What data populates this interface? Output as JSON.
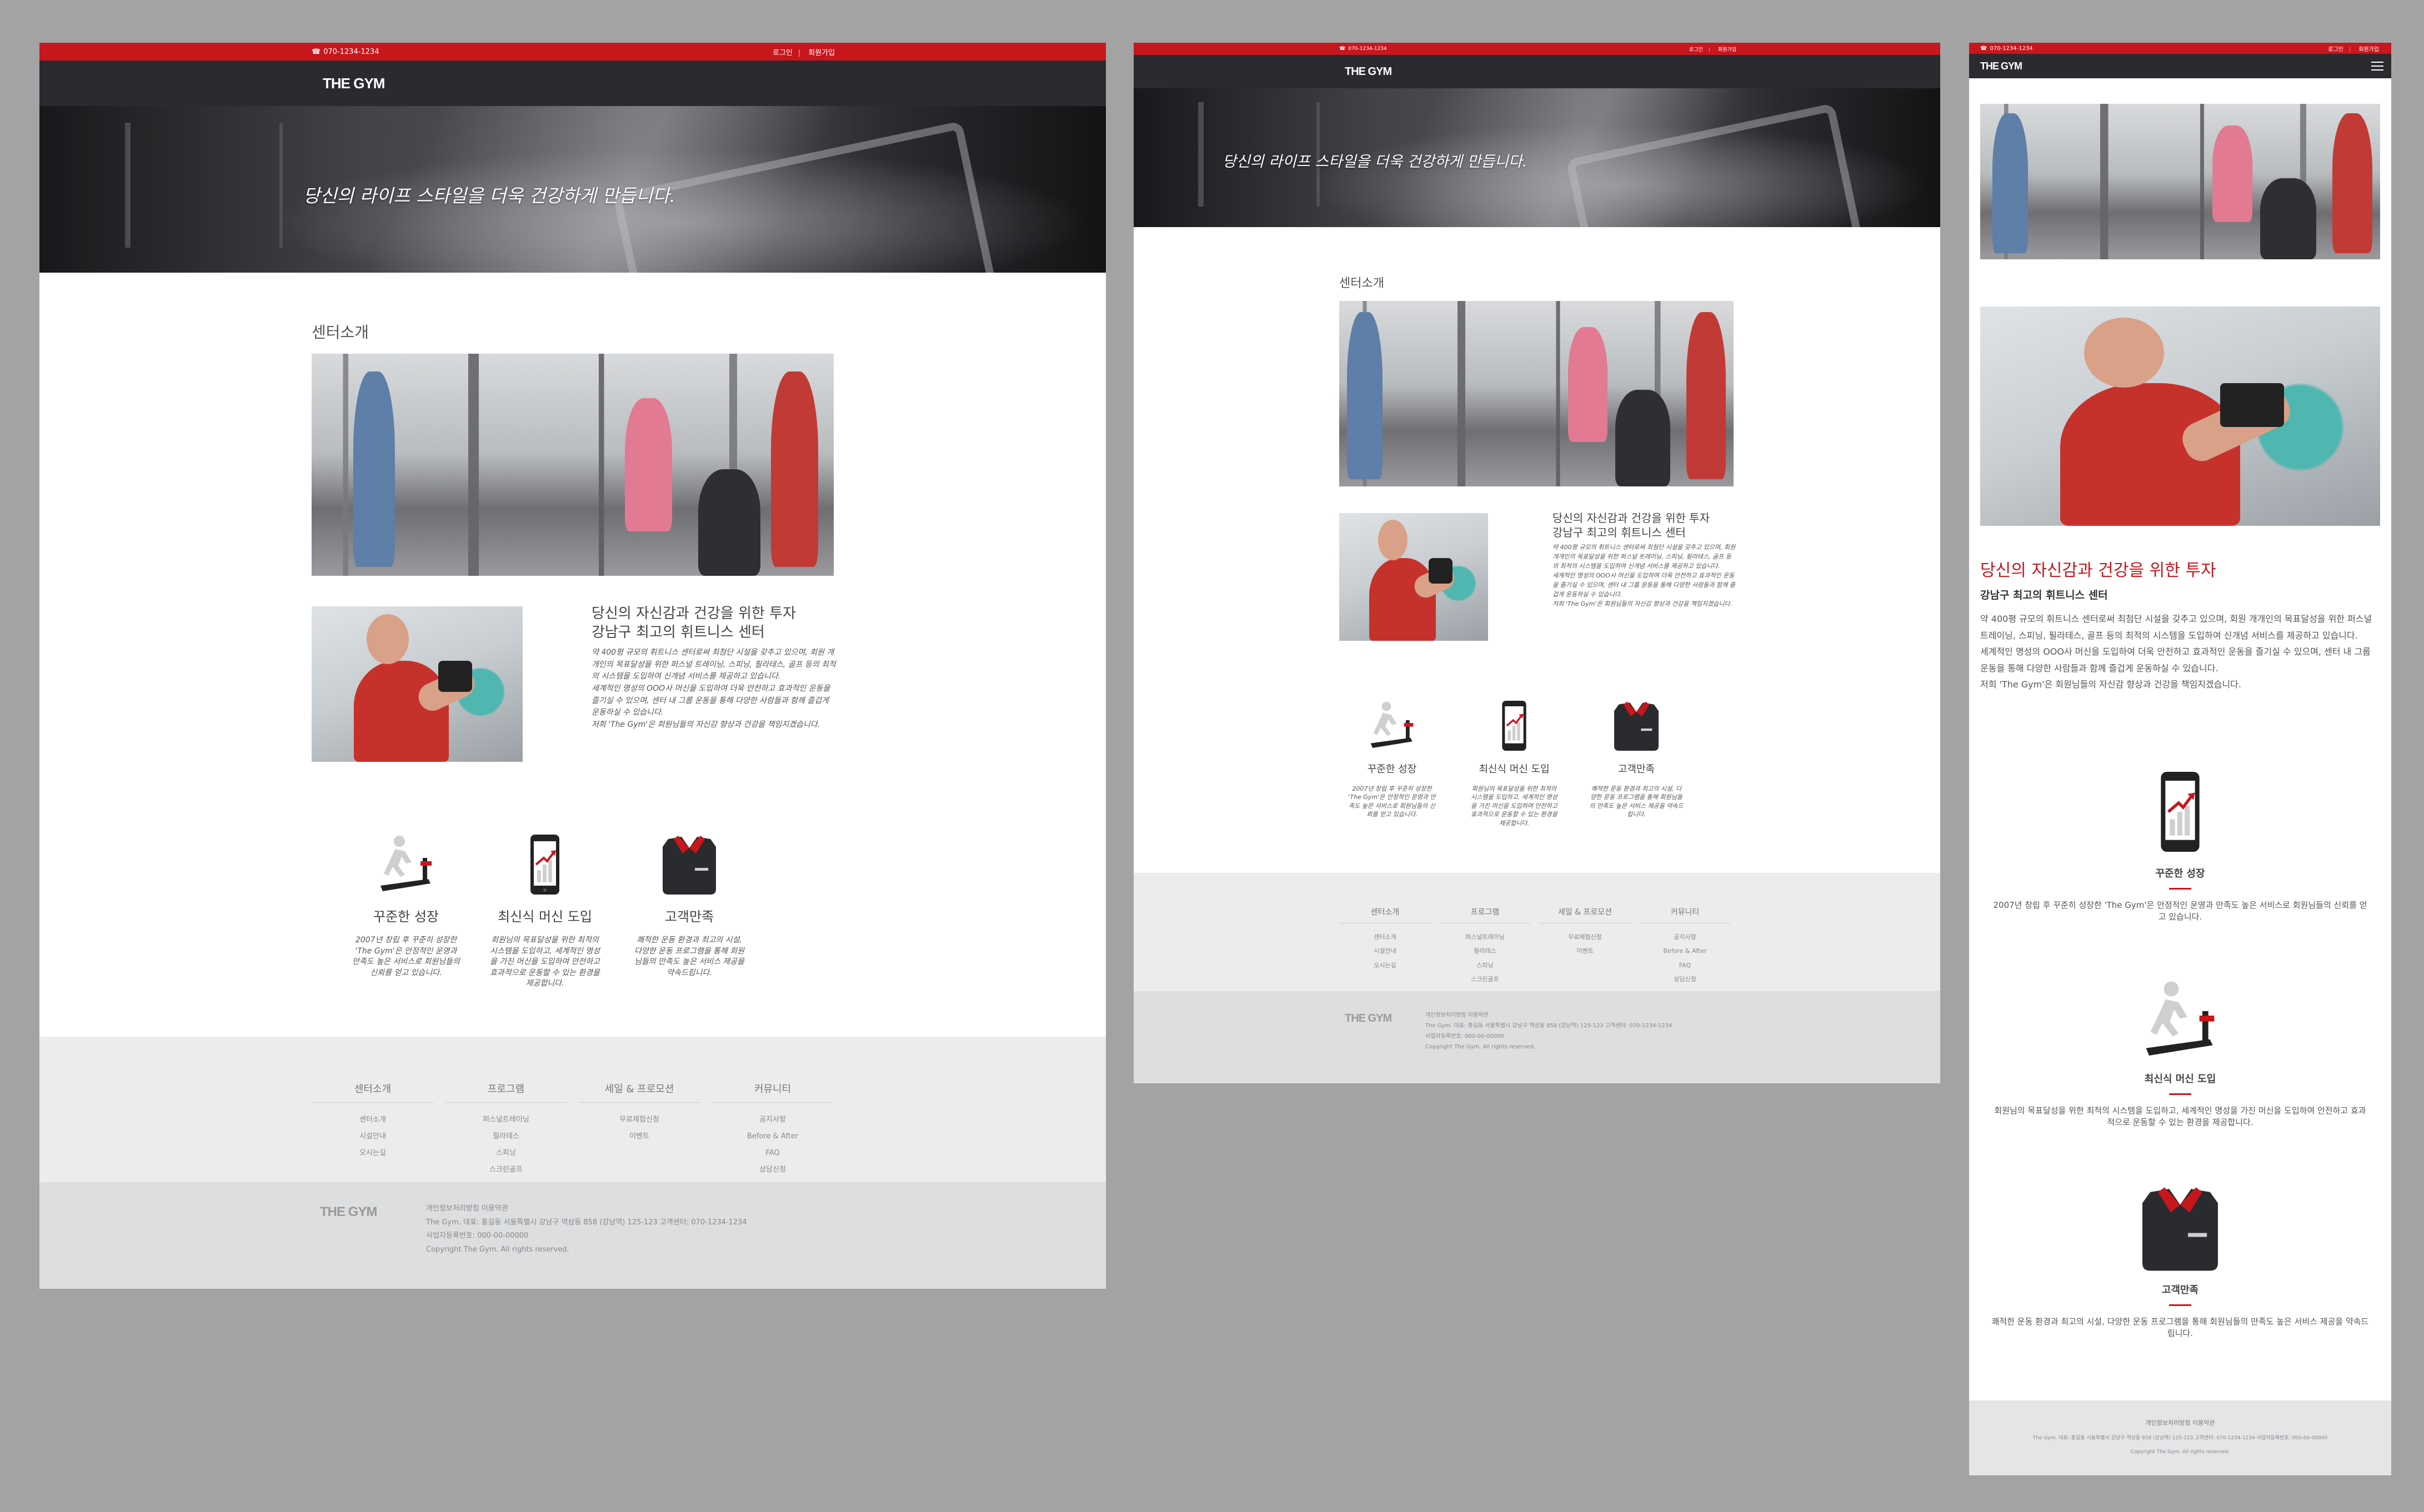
{
  "phone": "070-1234-1234",
  "top_links": [
    "로그인",
    "회원가입"
  ],
  "logo": "THE GYM",
  "hero_text": "당신의 라이프 스타일을 더욱 건강하게 만듭니다.",
  "section_title": "센터소개",
  "intro": {
    "heading_line1": "당신의 자신감과 건강을 위한 투자",
    "heading_line2": "강남구 최고의 휘트니스 센터",
    "paragraph1": "약 400평 규모의 휘트니스 센터로써 최첨단 시설을 갖추고 있으며, 회원 개개인의 목표달성을 위한 퍼스널 트레이닝, 스피닝, 필라테스, 골프 등의 최적의 시스템을 도입하여 신개념 서비스를 제공하고 있습니다.",
    "paragraph2": "세계적인 명성의 OOO사 머신을 도입하여 더욱 안전하고 효과적인 운동을 즐기실 수 있으며, 센터 내 그룹 운동을 통해 다양한 사람들과 함께 즐겁게 운동하실 수 있습니다.",
    "paragraph3": "저희 'The Gym'은 회원님들의 자신감 향상과 건강을 책임지겠습니다."
  },
  "features": [
    {
      "title": "꾸준한 성장",
      "desc": "2007년 창립 후 꾸준히 성장한 'The Gym'은 안정적인 운영과 만족도 높은 서비스로 회원님들의 신뢰를 얻고 있습니다."
    },
    {
      "title": "최신식 머신 도입",
      "desc": "회원님의 목표달성을 위한 최적의 시스템을 도입하고, 세계적인 명성을 가진 머신을 도입하여 안전하고 효과적으로 운동할 수 있는 환경을 제공합니다."
    },
    {
      "title": "고객만족",
      "desc": "쾌적한 운동 환경과 최고의 시설, 다양한 운동 프로그램을 통해 회원님들의 만족도 높은 서비스 제공을 약속드립니다."
    }
  ],
  "footer_menu": [
    {
      "title": "센터소개",
      "items": [
        "센터소개",
        "시설안내",
        "오시는길"
      ]
    },
    {
      "title": "프로그램",
      "items": [
        "퍼스널트레이닝",
        "필라테스",
        "스피닝",
        "스크린골프"
      ]
    },
    {
      "title": "세일 & 프로모션",
      "items": [
        "무료체험신청",
        "이벤트"
      ]
    },
    {
      "title": "커뮤니티",
      "items": [
        "공지사항",
        "Before & After",
        "FAQ",
        "상담신청"
      ]
    }
  ],
  "footer": {
    "links": "개인정보처리방침   이용약관",
    "address_line": "The Gym. 대표: 홍길동      서울특별시 강남구 역삼동 858 (강남역) 125-123    고객센터: 070-1234-1234",
    "biz_no": "사업자등록번호: 000-00-00000",
    "copyright": "Copyright The Gym. All rights reserved.",
    "mobile_address_line": "The Gym.    대표: 홍길동     서울특별시 강남구 역삼동 858 (강남역) 125-123     고객센터: 070-1234-1234     사업자등록번호: 000-00-00000"
  },
  "colors": {
    "accent": "#c8161d",
    "nav": "#2a2b2e",
    "background": "#a3a3a3"
  }
}
